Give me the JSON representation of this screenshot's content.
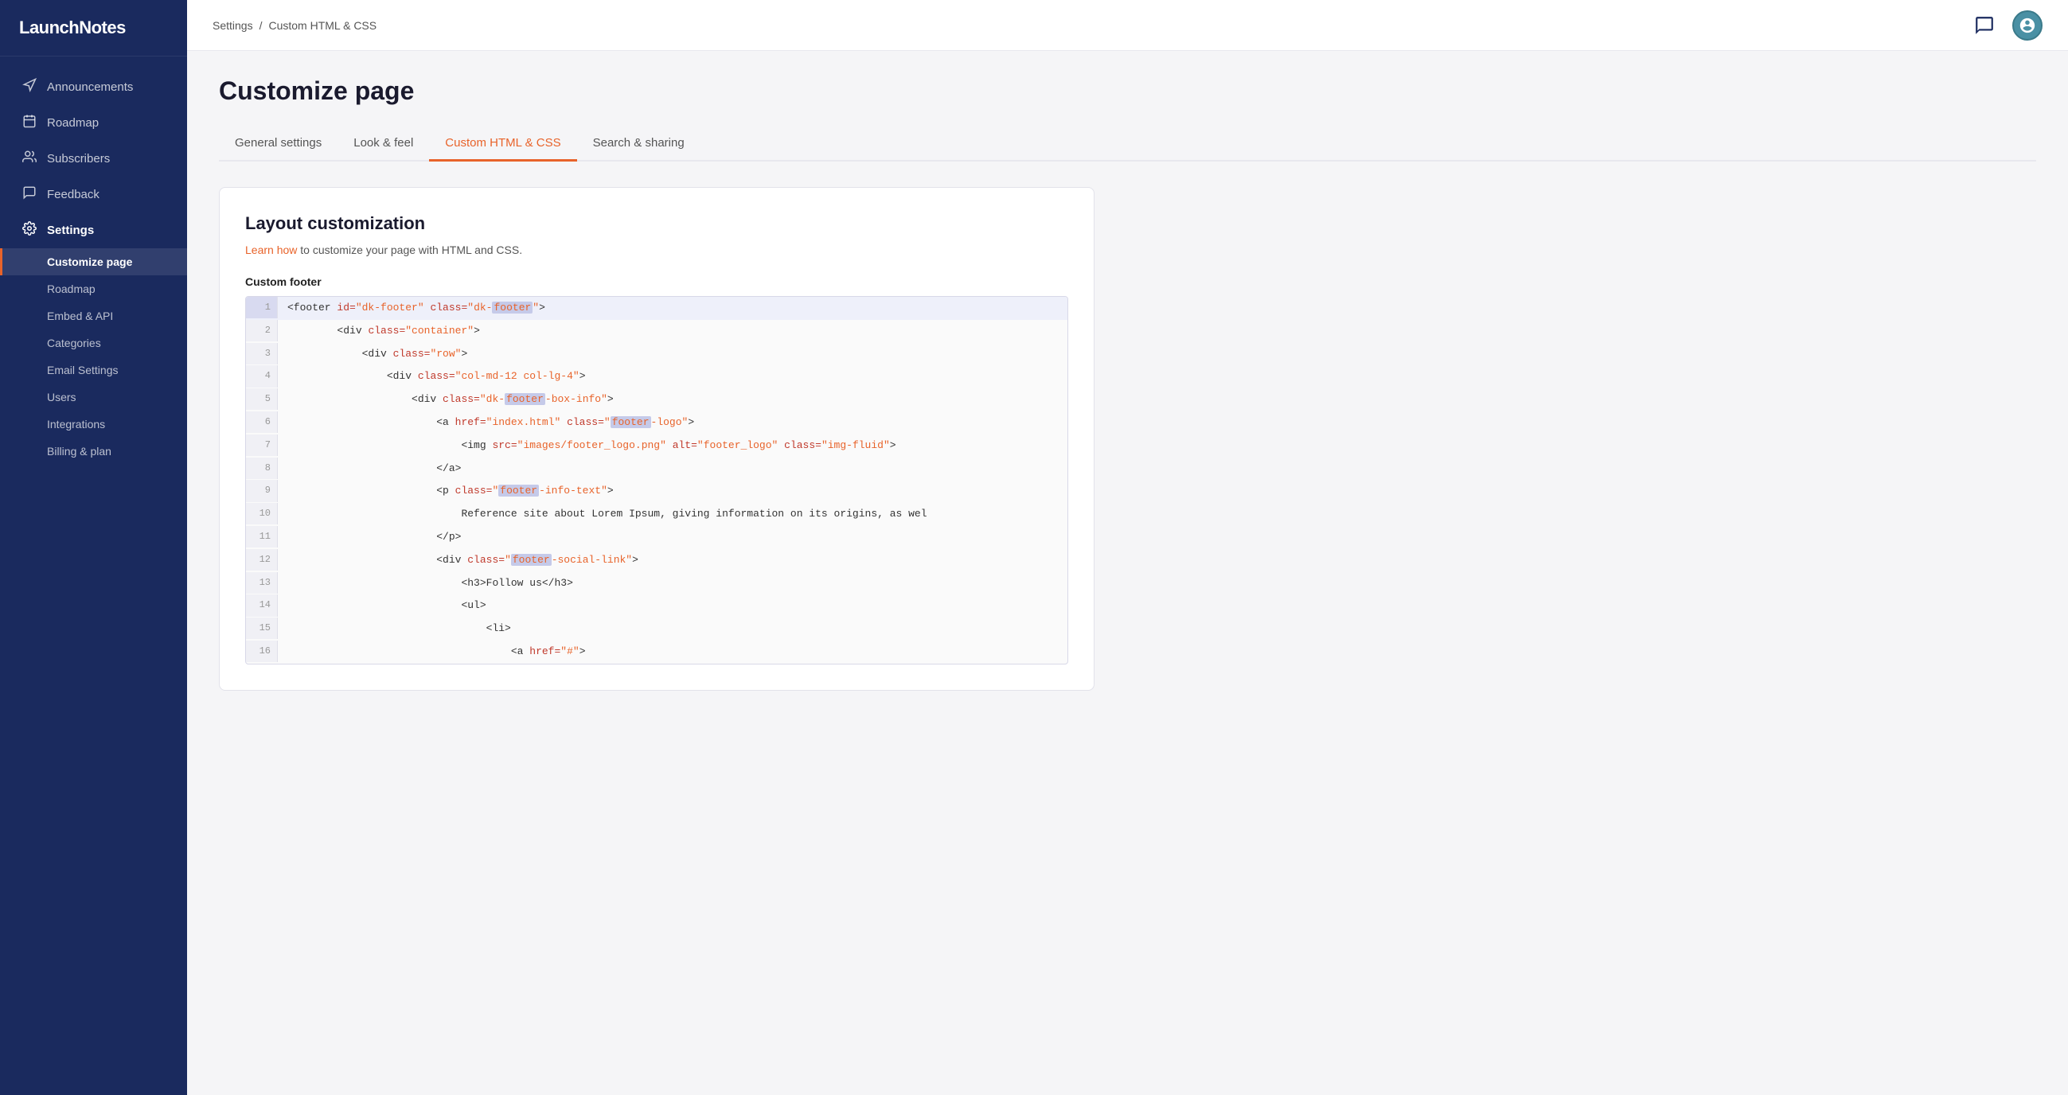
{
  "app": {
    "name": "LaunchNotes"
  },
  "header": {
    "breadcrumb_root": "Settings",
    "breadcrumb_sep": "/",
    "breadcrumb_current": "Custom HTML & CSS"
  },
  "sidebar": {
    "nav_items": [
      {
        "id": "announcements",
        "label": "Announcements",
        "icon": "📢"
      },
      {
        "id": "roadmap",
        "label": "Roadmap",
        "icon": "🗺"
      },
      {
        "id": "subscribers",
        "label": "Subscribers",
        "icon": "👤"
      },
      {
        "id": "feedback",
        "label": "Feedback",
        "icon": "💬"
      },
      {
        "id": "settings",
        "label": "Settings",
        "icon": "⚙",
        "active": true
      }
    ],
    "sub_nav": [
      {
        "id": "customize-page",
        "label": "Customize page",
        "active": true
      },
      {
        "id": "roadmap-sub",
        "label": "Roadmap"
      },
      {
        "id": "embed-api",
        "label": "Embed & API"
      },
      {
        "id": "categories",
        "label": "Categories"
      },
      {
        "id": "email-settings",
        "label": "Email Settings"
      },
      {
        "id": "users",
        "label": "Users"
      },
      {
        "id": "integrations",
        "label": "Integrations"
      },
      {
        "id": "billing",
        "label": "Billing & plan"
      }
    ]
  },
  "page": {
    "title": "Customize page",
    "tabs": [
      {
        "id": "general",
        "label": "General settings"
      },
      {
        "id": "look",
        "label": "Look & feel"
      },
      {
        "id": "custom-html",
        "label": "Custom HTML & CSS",
        "active": true
      },
      {
        "id": "search",
        "label": "Search & sharing"
      }
    ],
    "card": {
      "title": "Layout customization",
      "learn_text": "Learn how",
      "learn_rest": " to customize your page with HTML and CSS.",
      "section_label": "Custom footer",
      "code_lines": [
        {
          "num": 1,
          "active": true,
          "content": "<footer id=\"dk-footer\" class=\"dk-footer\">"
        },
        {
          "num": 2,
          "content": "        <div class=\"container\">"
        },
        {
          "num": 3,
          "content": "            <div class=\"row\">"
        },
        {
          "num": 4,
          "content": "                <div class=\"col-md-12 col-lg-4\">"
        },
        {
          "num": 5,
          "content": "                    <div class=\"dk-footer-box-info\">"
        },
        {
          "num": 6,
          "content": "                        <a href=\"index.html\" class=\"footer-logo\">"
        },
        {
          "num": 7,
          "content": "                            <img src=\"images/footer_logo.png\" alt=\"footer_logo\" class=\"img-fluid\">"
        },
        {
          "num": 8,
          "content": "                        </a>"
        },
        {
          "num": 9,
          "content": "                        <p class=\"footer-info-text\">"
        },
        {
          "num": 10,
          "content": "                            Reference site about Lorem Ipsum, giving information on its origins, as wel"
        },
        {
          "num": 11,
          "content": "                        </p>"
        },
        {
          "num": 12,
          "content": "                        <div class=\"footer-social-link\">"
        },
        {
          "num": 13,
          "content": "                            <h3>Follow us</h3>"
        },
        {
          "num": 14,
          "content": "                            <ul>"
        },
        {
          "num": 15,
          "content": "                                <li>"
        },
        {
          "num": 16,
          "content": "                                    <a href=\"#\">"
        }
      ]
    }
  }
}
